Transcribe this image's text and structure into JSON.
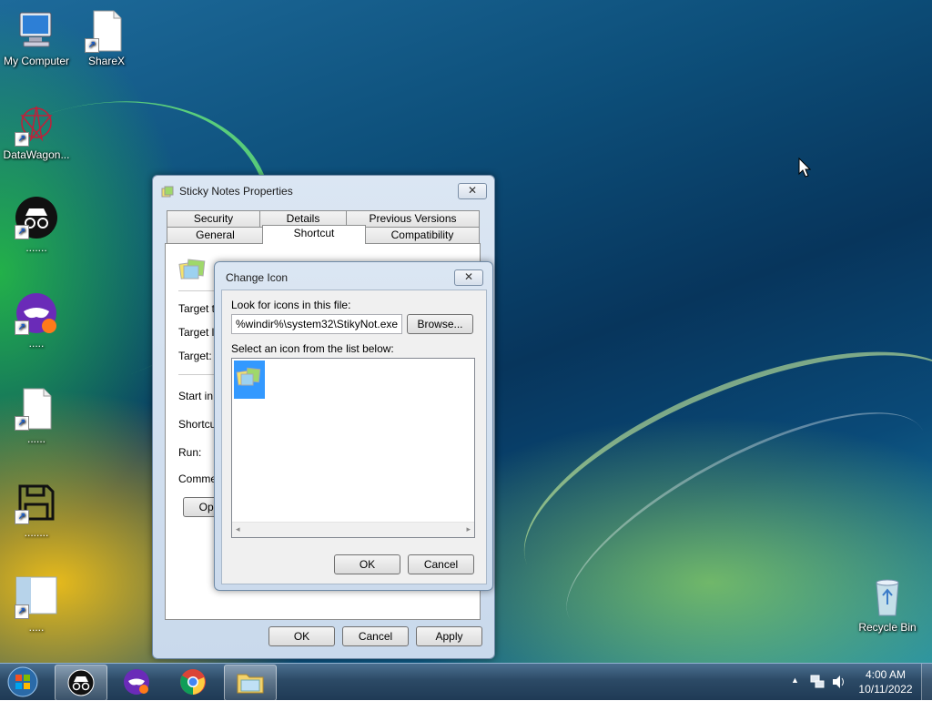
{
  "desktop": {
    "icons": [
      {
        "label": "My Computer"
      },
      {
        "label": "ShareX"
      },
      {
        "label": "DataWagon..."
      },
      {
        "label": "......."
      },
      {
        "label": "....."
      },
      {
        "label": "......"
      },
      {
        "label": "........"
      },
      {
        "label": "....."
      },
      {
        "label": "Recycle Bin"
      }
    ]
  },
  "properties": {
    "title": "Sticky Notes Properties",
    "close_label": "✕",
    "tabs_row1": [
      "Security",
      "Details",
      "Previous Versions"
    ],
    "tabs_row2": [
      "General",
      "Shortcut",
      "Compatibility"
    ],
    "active_tab": "Shortcut",
    "fields": [
      "Target ty",
      "Target lo",
      "Target:",
      "Start in:",
      "Shortcut",
      "Run:",
      "Commen"
    ],
    "open_button_partial": "Oper",
    "ok": "OK",
    "cancel": "Cancel",
    "apply": "Apply"
  },
  "change_icon": {
    "title": "Change Icon",
    "close_label": "✕",
    "file_label": "Look for icons in this file:",
    "file_value": "%windir%\\system32\\StikyNot.exe",
    "browse": "Browse...",
    "list_label": "Select an icon from the list below:",
    "ok": "OK",
    "cancel": "Cancel"
  },
  "taskbar": {
    "time": "4:00 AM",
    "date": "10/11/2022",
    "tray_chevron": "▲"
  },
  "colors": {
    "accent": "#3399ff",
    "selection": "#cce8ff"
  }
}
